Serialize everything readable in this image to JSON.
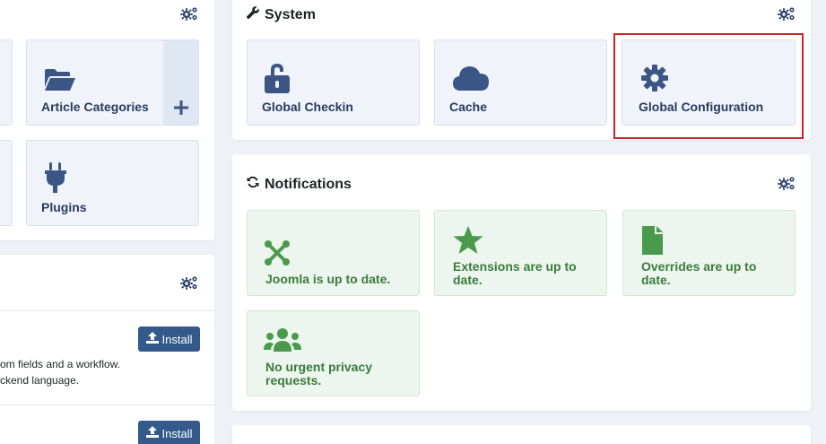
{
  "system": {
    "title": "System",
    "tiles": [
      {
        "label": "Global Checkin",
        "icon": "lock-open-icon"
      },
      {
        "label": "Cache",
        "icon": "cloud-icon"
      },
      {
        "label": "Global Configuration",
        "icon": "gear-icon"
      }
    ]
  },
  "content": {
    "tiles": [
      {
        "label": "Article Categories",
        "icon": "folder-open-icon",
        "add_icon": "plus-icon"
      },
      {
        "label": "Plugins",
        "icon": "plug-icon"
      }
    ]
  },
  "notifications": {
    "title": "Notifications",
    "tiles": [
      {
        "line1": "Joomla is up to date.",
        "line2": "",
        "icon": "joomla-icon"
      },
      {
        "line1": "Extensions are up to",
        "line2": "date.",
        "icon": "star-icon"
      },
      {
        "line1": "Overrides are up to",
        "line2": "date.",
        "icon": "file-icon"
      },
      {
        "line1": "No urgent privacy",
        "line2": "requests.",
        "icon": "users-icon"
      }
    ]
  },
  "sample_data": {
    "install_label": "Install",
    "item1_desc_line1": "om fields and a workflow.",
    "item1_desc_line2": "ckend language."
  },
  "colors": {
    "accent_blue": "#335a8a",
    "highlight_red": "#cc2128",
    "success_green": "#3a7b3c"
  }
}
